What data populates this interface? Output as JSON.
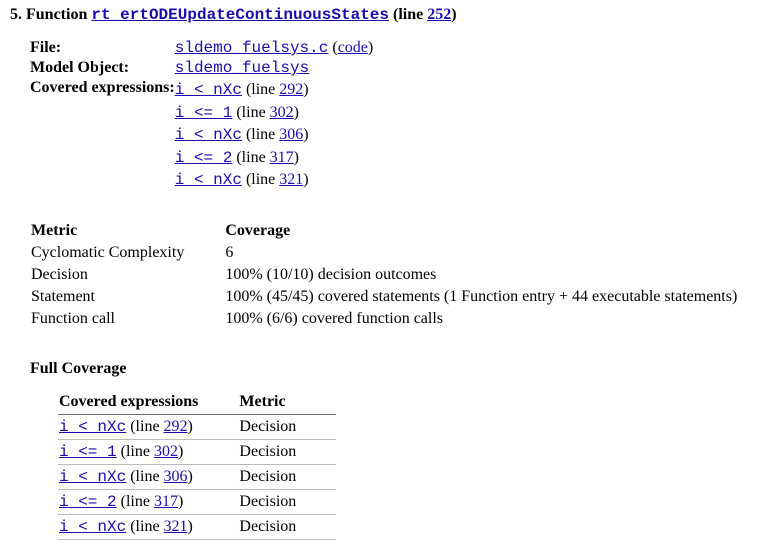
{
  "heading": {
    "number": "5.",
    "label": "Function",
    "function_name": "rt_ertODEUpdateContinuousStates",
    "line_prefix": "(line ",
    "line_number": "252",
    "line_suffix": ")"
  },
  "info": {
    "file_label": "File:",
    "file_name": "sldemo_fuelsys.c",
    "file_code_label": "code",
    "model_label": "Model Object:",
    "model_name": "sldemo_fuelsys",
    "covered_label": "Covered expressions:",
    "expressions": [
      {
        "expr": "i < nXc",
        "line_prefix": "(line ",
        "line": "292",
        "line_suffix": ")"
      },
      {
        "expr": "i <= 1",
        "line_prefix": "(line ",
        "line": "302",
        "line_suffix": ")"
      },
      {
        "expr": "i < nXc",
        "line_prefix": "(line ",
        "line": "306",
        "line_suffix": ")"
      },
      {
        "expr": "i <= 2",
        "line_prefix": "(line ",
        "line": "317",
        "line_suffix": ")"
      },
      {
        "expr": "i < nXc",
        "line_prefix": "(line ",
        "line": "321",
        "line_suffix": ")"
      }
    ]
  },
  "metrics": {
    "col_metric": "Metric",
    "col_coverage": "Coverage",
    "rows": [
      {
        "metric": "Cyclomatic Complexity",
        "coverage": "6"
      },
      {
        "metric": "Decision",
        "coverage": "100% (10/10) decision outcomes"
      },
      {
        "metric": "Statement",
        "coverage": "100% (45/45) covered statements (1 Function entry + 44 executable statements)"
      },
      {
        "metric": "Function call",
        "coverage": "100% (6/6) covered function calls"
      }
    ]
  },
  "full_coverage": {
    "heading": "Full Coverage",
    "col_expr": "Covered expressions",
    "col_metric": "Metric",
    "rows": [
      {
        "expr": "i < nXc",
        "line_prefix": "(line ",
        "line": "292",
        "line_suffix": ")",
        "metric": "Decision"
      },
      {
        "expr": "i <= 1",
        "line_prefix": "(line ",
        "line": "302",
        "line_suffix": ")",
        "metric": "Decision"
      },
      {
        "expr": "i < nXc",
        "line_prefix": "(line ",
        "line": "306",
        "line_suffix": ")",
        "metric": "Decision"
      },
      {
        "expr": "i <= 2",
        "line_prefix": "(line ",
        "line": "317",
        "line_suffix": ")",
        "metric": "Decision"
      },
      {
        "expr": "i < nXc",
        "line_prefix": "(line ",
        "line": "321",
        "line_suffix": ")",
        "metric": "Decision"
      }
    ]
  }
}
